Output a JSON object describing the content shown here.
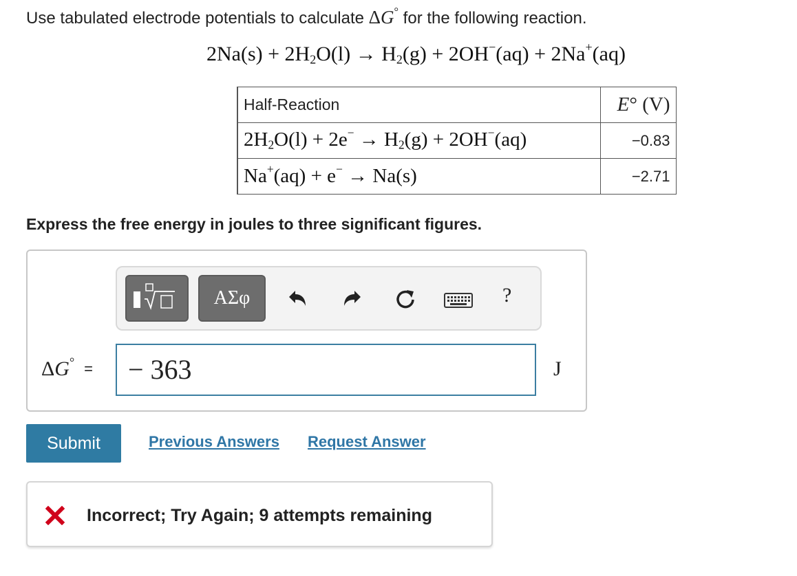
{
  "question": {
    "prompt_before": "Use tabulated electrode potentials to calculate ",
    "delta_symbol": "Δ",
    "g_symbol": "G",
    "degree": "°",
    "prompt_after": " for the following reaction.",
    "instruction": "Express the free energy in joules to three significant figures."
  },
  "table": {
    "header_reaction": "Half-Reaction",
    "header_e_symbol": "E",
    "header_e_unit": "° (V)",
    "rows": [
      {
        "potential": "−0.83"
      },
      {
        "potential": "−2.71"
      }
    ]
  },
  "toolbar": {
    "symbols_label": "ΑΣφ",
    "help_label": "?"
  },
  "answer": {
    "label_delta": "Δ",
    "label_g": "G",
    "label_degree": "°",
    "equals": "=",
    "value": "− 363",
    "unit": "J"
  },
  "actions": {
    "submit_label": "Submit",
    "previous_answers_label": "Previous Answers",
    "request_answer_label": "Request Answer"
  },
  "feedback": {
    "message": "Incorrect; Try Again; 9 attempts remaining",
    "status_color": "#d0021b"
  },
  "colors": {
    "accent": "#2f7ba3",
    "link": "#2f76a6",
    "input_border": "#3b7ea1"
  }
}
